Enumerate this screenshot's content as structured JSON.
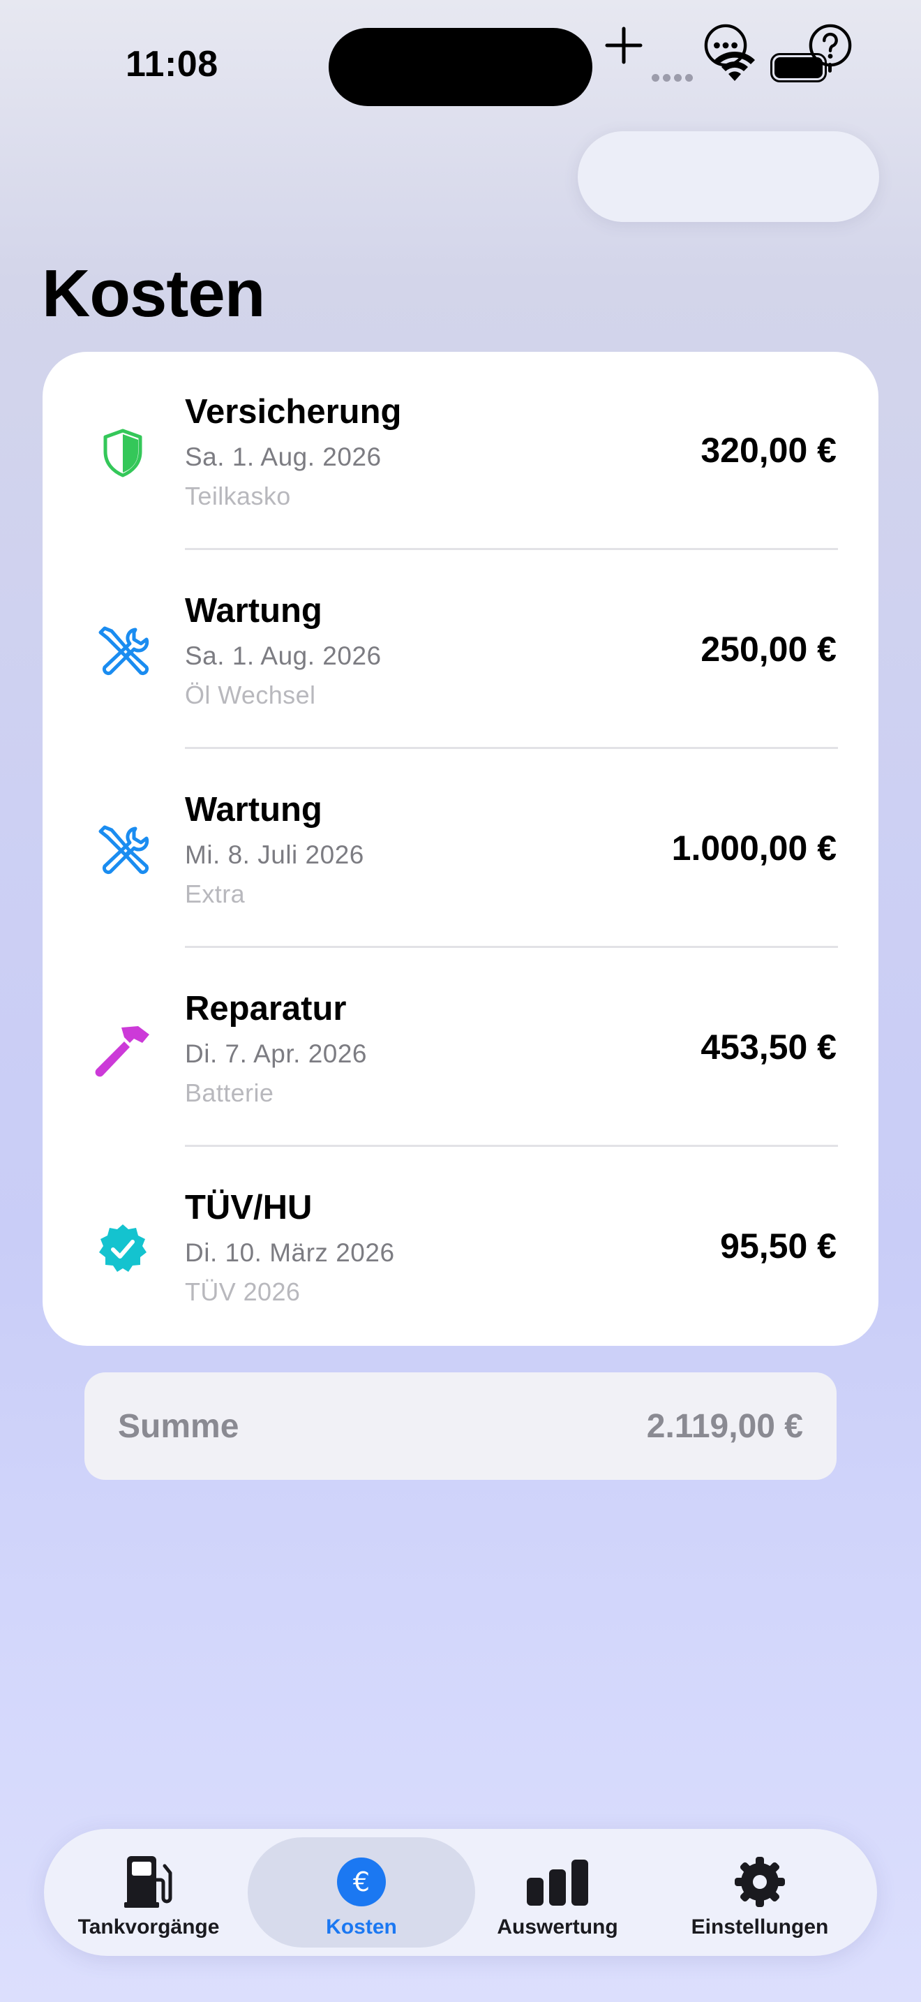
{
  "status_bar": {
    "time": "11:08"
  },
  "page": {
    "title": "Kosten"
  },
  "toolbar": {
    "add_icon": "plus-icon",
    "more_icon": "ellipsis-circle-icon",
    "help_icon": "question-circle-icon"
  },
  "entries": [
    {
      "category": "Versicherung",
      "date": "Sa. 1. Aug. 2026",
      "note": "Teilkasko",
      "amount": "320,00 €",
      "icon": "shield-icon",
      "color": "#34c759"
    },
    {
      "category": "Wartung",
      "date": "Sa. 1. Aug. 2026",
      "note": "Öl Wechsel",
      "amount": "250,00 €",
      "icon": "wrench-screwdriver-icon",
      "color": "#1a8cf0"
    },
    {
      "category": "Wartung",
      "date": "Mi. 8. Juli 2026",
      "note": "Extra",
      "amount": "1.000,00 €",
      "icon": "wrench-screwdriver-icon",
      "color": "#1a8cf0"
    },
    {
      "category": "Reparatur",
      "date": "Di. 7. Apr. 2026",
      "note": "Batterie",
      "amount": "453,50 €",
      "icon": "hammer-icon",
      "color": "#cc3ad8"
    },
    {
      "category": "TÜV/HU",
      "date": "Di. 10. März 2026",
      "note": "TÜV 2026",
      "amount": "95,50 €",
      "icon": "checkmark-seal-icon",
      "color": "#14c3cf"
    }
  ],
  "summary": {
    "label": "Summe",
    "value": "2.119,00 €"
  },
  "tabs": [
    {
      "label": "Tankvorgänge",
      "icon": "fuel-pump-icon",
      "active": false
    },
    {
      "label": "Kosten",
      "icon": "euro-circle-icon",
      "active": true
    },
    {
      "label": "Auswertung",
      "icon": "bar-chart-icon",
      "active": false
    },
    {
      "label": "Einstellungen",
      "icon": "gear-icon",
      "active": false
    }
  ],
  "colors": {
    "accent": "#1b78f2",
    "background": "#cdd0f3"
  }
}
